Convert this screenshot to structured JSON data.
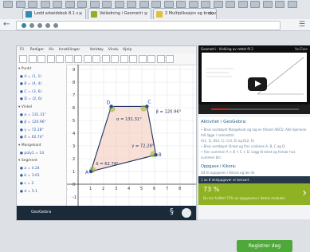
{
  "browser": {
    "tabs": [
      {
        "label": "Ledd arbeidsbok 8.1 s",
        "fav": "#2e8fb5"
      },
      {
        "label": "Veiledning i Geometri",
        "fav": "#8fb224"
      },
      {
        "label": "2 Multiplikasjon og brøkas",
        "fav": "#e2c13a"
      }
    ],
    "back_icon": "arrow-left-icon",
    "menu_icon": "hamburger-menu-icon"
  },
  "geogebra": {
    "menu": [
      "Fil",
      "Rediger",
      "Vis",
      "Innstillinger",
      "Verktøy",
      "Vindu",
      "Hjelp"
    ],
    "tools_count": 17,
    "algebra": [
      {
        "label": "Punkt",
        "hdr": true
      },
      {
        "label": "A = (1, 1)"
      },
      {
        "label": "B = (4, 4)"
      },
      {
        "label": "C = (3, 6)"
      },
      {
        "label": "D = (2, 6)"
      },
      {
        "label": "Vinkel",
        "hdr": true
      },
      {
        "label": "α = 131.31°"
      },
      {
        "label": "β = 120.96°"
      },
      {
        "label": "γ = 72.28°"
      },
      {
        "label": "δ = 62.74°"
      },
      {
        "label": "Mangekant",
        "hdr": true
      },
      {
        "label": "poly1 = 14"
      },
      {
        "label": "Segment",
        "hdr": true
      },
      {
        "label": "a = 4.24"
      },
      {
        "label": "b = 3.61"
      },
      {
        "label": "c = 2"
      },
      {
        "label": "d = 5.1"
      }
    ],
    "angles": {
      "alpha": "α = 131.31°",
      "beta": "β = 120.96°",
      "gamma": "γ = 72.28°",
      "delta": "δ = 62.74°"
    },
    "points": {
      "A": "A",
      "B": "B",
      "C": "C",
      "D": "D"
    },
    "x_ticks": [
      "-1",
      "0",
      "1",
      "2",
      "3",
      "4",
      "5",
      "6",
      "7",
      "8"
    ],
    "y_ticks": [
      "9",
      "8",
      "7",
      "6",
      "5",
      "4",
      "3",
      "2",
      "1",
      "0",
      "-1"
    ],
    "footer_brand": "GeoGebra"
  },
  "video": {
    "title": "Geometri - Vinkling av rettet fil 2",
    "badge": "YouTube",
    "play_icon": "play-icon"
  },
  "instructions": {
    "heading": "Aktivitet i GeoGebra:",
    "lines": [
      "• Bruk verktøyet Mangekant og lag en firkant ABCD. Alle hjørnene",
      "  må ligge i rutenettet.",
      "  A(1, 1), B(4, 1), C(3, 6) og D(2, 6)",
      "• Bruk verktøyet Vinkel og finn vinklene A, B, C og D.",
      "• Finn summen A + B + C + D. Legg til tekst og forklar hva",
      "  summen blir."
    ],
    "task_heading": "Oppgave i Kikora:",
    "task_line": "Gå til oppgaven i Kikora og løs de"
  },
  "tagbar": "1 av 8 deloppgaver er besvart",
  "score": {
    "value": "73 %",
    "caption": "Du har fullført 73% av oppgavene i denne modulen"
  },
  "register_button": "Registrer deg"
}
